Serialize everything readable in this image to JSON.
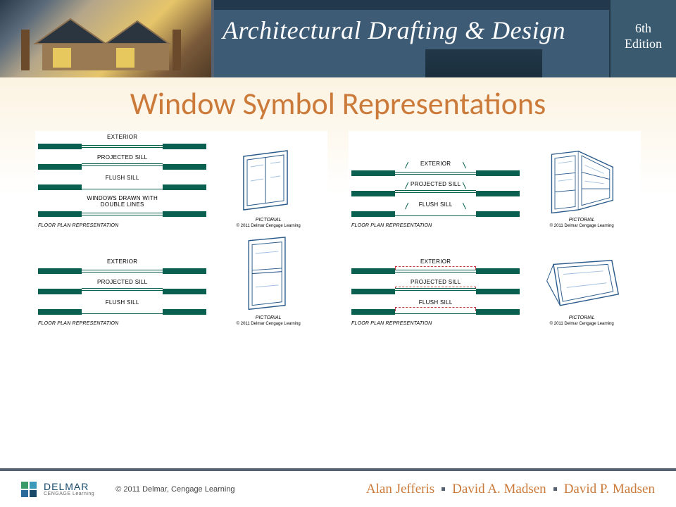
{
  "banner": {
    "title": "Architectural Drafting & Design",
    "edition_line1": "6th",
    "edition_line2": "Edition"
  },
  "slide": {
    "title": "Window Symbol Representations"
  },
  "labels": {
    "exterior": "EXTERIOR",
    "projected_sill": "PROJECTED SILL",
    "flush_sill": "FLUSH SILL",
    "double_lines": "WINDOWS DRAWN WITH\nDOUBLE LINES",
    "floor_plan": "FLOOR PLAN REPRESENTATION",
    "pictorial": "PICTORIAL",
    "diagram_copyright": "© 2011 Delmar Cengage Learning"
  },
  "footer": {
    "logo_main": "DELMAR",
    "logo_sub": "CENGAGE Learning",
    "copyright": "© 2011 Delmar, Cengage Learning",
    "authors": [
      "Alan Jefferis",
      "David A. Madsen",
      "David P. Madsen"
    ]
  }
}
